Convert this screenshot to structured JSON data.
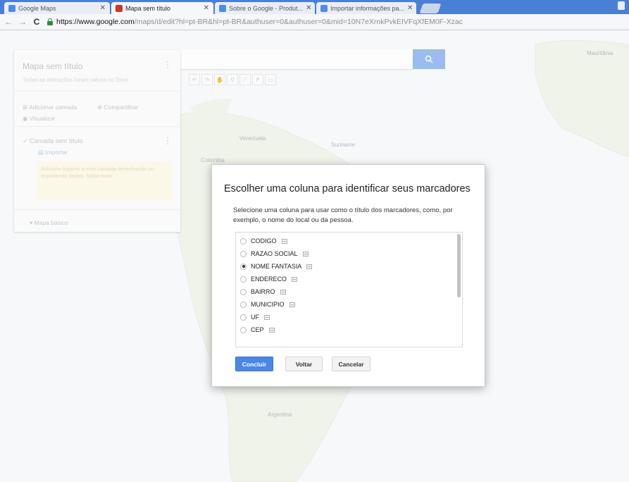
{
  "browser": {
    "tabs": [
      {
        "title": "Google Maps",
        "favicon_color": "#4c8bf5",
        "active": false
      },
      {
        "title": "Mapa sem título",
        "favicon_color": "#d93025",
        "active": true
      },
      {
        "title": "Sobre o Google - Produt...",
        "favicon_color": "#4c8bf5",
        "active": false
      },
      {
        "title": "Importar informações pa...",
        "favicon_color": "#4c8bf5",
        "active": false
      }
    ],
    "url_host": "https://www.google.com",
    "url_rest": "/maps/d/edit?hl=pt-BR&hl=pt-BR&authuser=0&authuser=0&mid=10N7eXrnkPvkEIVFqXfEM0F-Xzac"
  },
  "left_panel": {
    "title": "Mapa sem título",
    "description": "Todas as alterações foram salvas no Drive",
    "add_layer": "Adicionar camada",
    "share": "Compartilhar",
    "preview": "Visualizar",
    "layer_name": "Camada sem título",
    "import_label": "Importar",
    "hint": "Adicione lugares a esta camada desenhando ou importando dados. Saiba mais",
    "base_map": "Mapa básico"
  },
  "map_labels": {
    "venezuela": "Venezuela",
    "colombia": "Colombia",
    "suriname": "Suriname",
    "argentina": "Argentina",
    "mauritania": "Mauritânia"
  },
  "dialog": {
    "title": "Escolher uma coluna para identificar seus marcadores",
    "description": "Selecione uma coluna para usar como o título dos marcadores, como, por exemplo, o nome do local ou da pessoa.",
    "columns": [
      {
        "name": "CODIGO",
        "selected": false
      },
      {
        "name": "RAZAO SOCIAL",
        "selected": false
      },
      {
        "name": "NOME FANTASIA",
        "selected": true
      },
      {
        "name": "ENDERECO",
        "selected": false
      },
      {
        "name": "BAIRRO",
        "selected": false
      },
      {
        "name": "MUNICIPIO",
        "selected": false
      },
      {
        "name": "UF",
        "selected": false
      },
      {
        "name": "CEP",
        "selected": false
      }
    ],
    "finish_label": "Concluir",
    "back_label": "Voltar",
    "cancel_label": "Cancelar"
  },
  "colors": {
    "accent": "#4a86e8",
    "tabstrip": "#4a7fd6",
    "lock_green": "#2e8b3e"
  }
}
